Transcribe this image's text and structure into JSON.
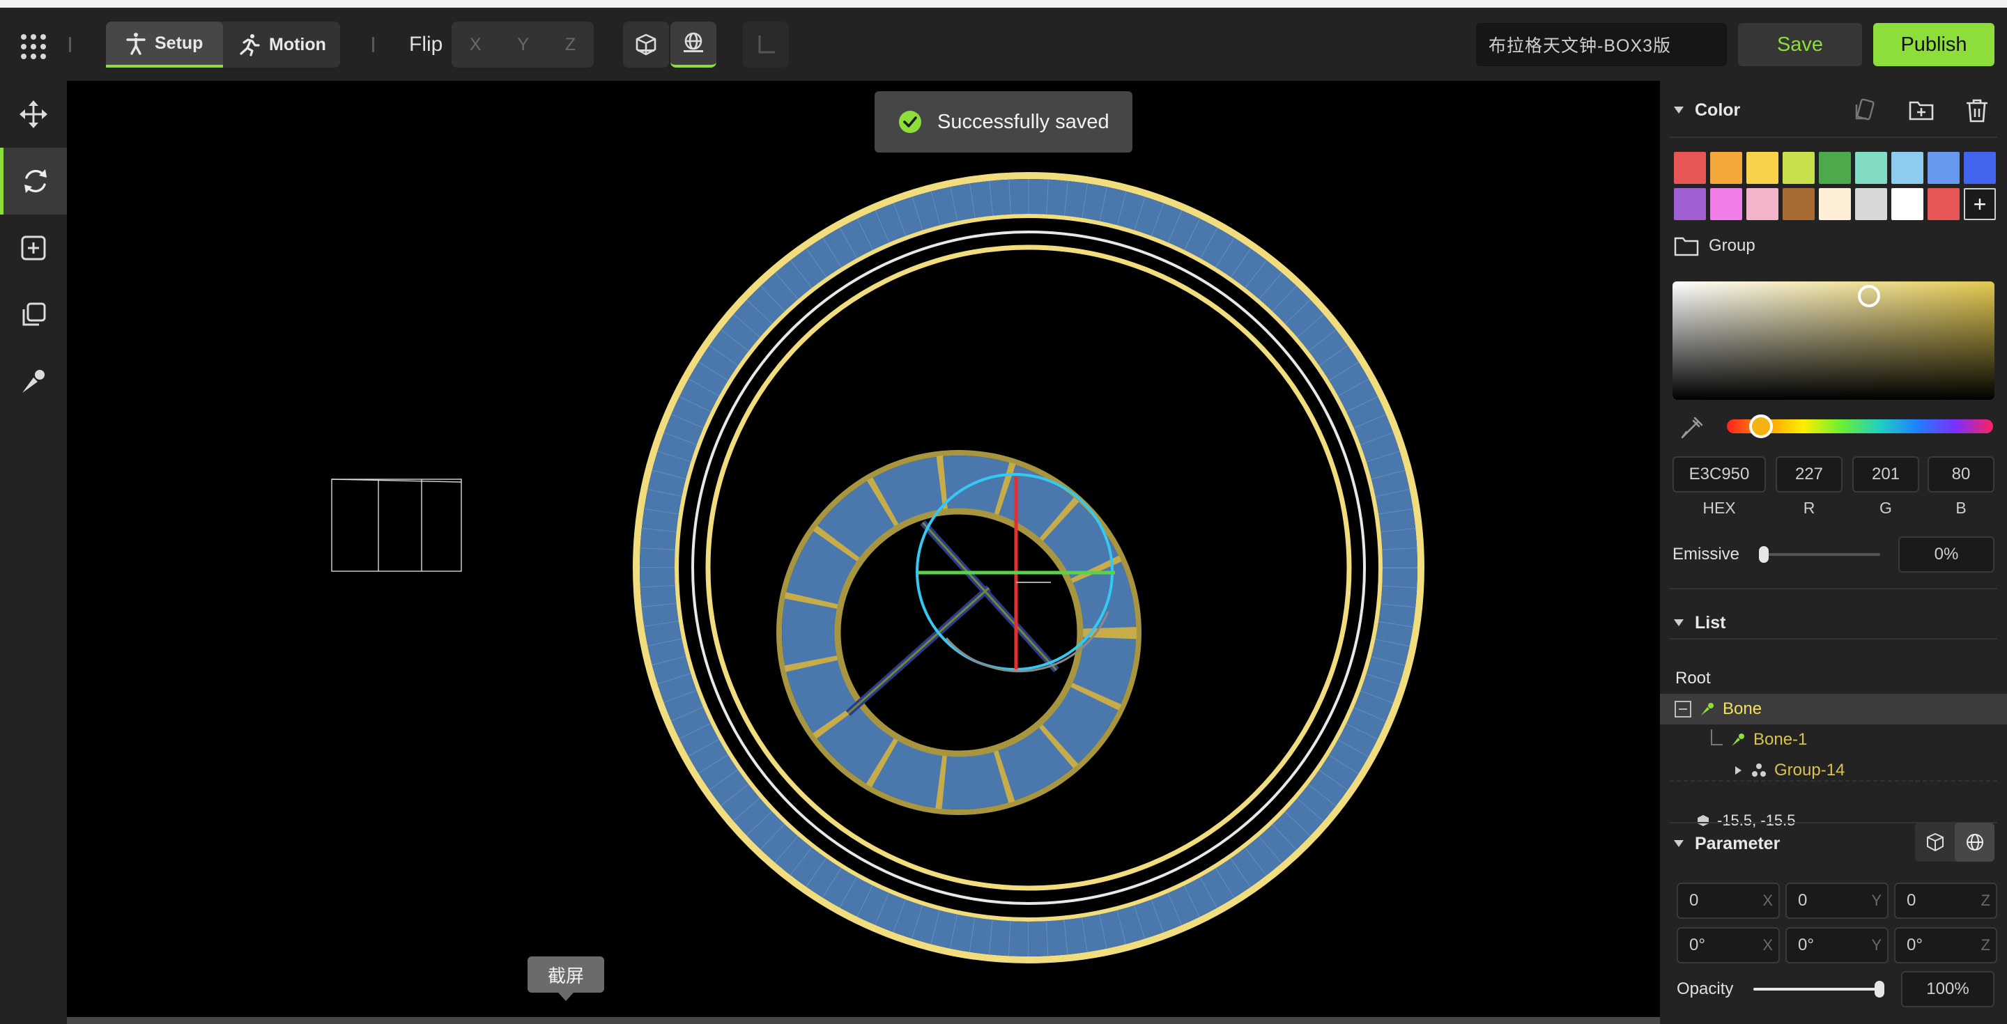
{
  "toolbar": {
    "modes": {
      "setup": "Setup",
      "motion": "Motion"
    },
    "flip_label": "Flip",
    "axes": [
      "X",
      "Y",
      "Z"
    ],
    "model_name": "布拉格天文钟-BOX3版",
    "save_label": "Save",
    "publish_label": "Publish"
  },
  "viewport": {
    "toast": "Successfully saved",
    "tooltip": "截屏"
  },
  "color_panel": {
    "title": "Color",
    "swatches": [
      "#e85555",
      "#f4a83a",
      "#f7d24a",
      "#c7e04b",
      "#4caa4c",
      "#82dcc4",
      "#8ecbef",
      "#6699ee",
      "#4466ee",
      "#a05fd3",
      "#ef7ee8",
      "#f4b4cc",
      "#a86b33",
      "#fdeed8",
      "#d8d8d8",
      "#ffffff",
      "#e85555"
    ],
    "add_label": "+",
    "group_label": "Group",
    "current_color": "#e3c950",
    "hex": "E3C950",
    "r": "227",
    "g": "201",
    "b": "80",
    "labels": {
      "hex": "HEX",
      "r": "R",
      "g": "G",
      "b": "B"
    },
    "emissive_label": "Emissive",
    "emissive_value": "0%",
    "emissive_level": 0
  },
  "list_panel": {
    "title": "List",
    "root": "Root",
    "items": [
      {
        "label": "Bone"
      },
      {
        "label": "Bone-1"
      },
      {
        "label": "Group-14"
      }
    ],
    "coords": "-15.5, -15.5"
  },
  "parameter_panel": {
    "title": "Parameter",
    "position": [
      {
        "value": "0",
        "axis": "X"
      },
      {
        "value": "0",
        "axis": "Y"
      },
      {
        "value": "0",
        "axis": "Z"
      }
    ],
    "rotation": [
      {
        "value": "0°",
        "axis": "X"
      },
      {
        "value": "0°",
        "axis": "Y"
      },
      {
        "value": "0°",
        "axis": "Z"
      }
    ],
    "opacity_label": "Opacity",
    "opacity_value": "100%",
    "opacity_level": 1
  },
  "left_tools": [
    "move-tool",
    "rotate-tool",
    "add-tool",
    "duplicate-tool",
    "bone-pen-tool"
  ],
  "accent_color": "#8dde3a"
}
